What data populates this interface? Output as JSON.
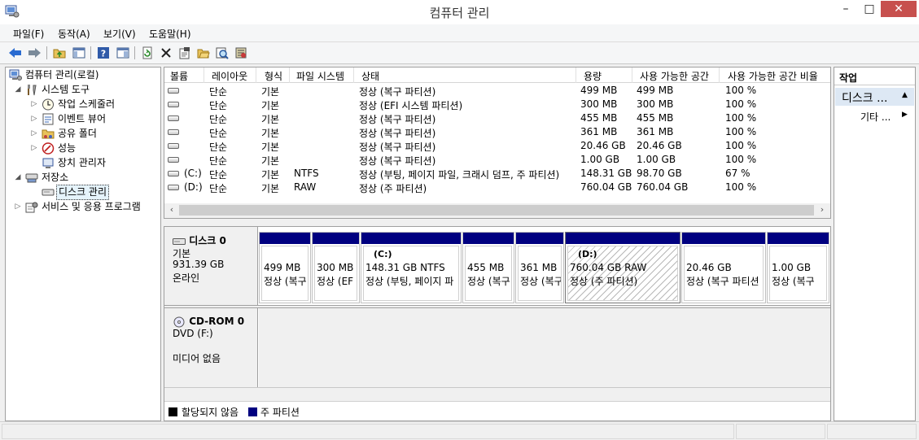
{
  "window": {
    "title": "컴퓨터 관리",
    "min": "–",
    "max": "□",
    "close": "✕"
  },
  "menu": [
    "파일(F)",
    "동작(A)",
    "보기(V)",
    "도움말(H)"
  ],
  "toolbar": [
    "back-icon",
    "forward-icon",
    "up-folder-icon",
    "show-hide-tree-icon",
    "help-icon",
    "properties-pane-icon",
    "refresh-icon",
    "delete-icon",
    "properties-icon",
    "open-folder-icon",
    "search-icon",
    "settings-icon"
  ],
  "tree": {
    "root": "컴퓨터 관리(로컬)",
    "system_tools": "시스템 도구",
    "task_scheduler": "작업 스케줄러",
    "event_viewer": "이벤트 뷰어",
    "shared_folders": "공유 폴더",
    "performance": "성능",
    "device_manager": "장치 관리자",
    "storage": "저장소",
    "disk_management": "디스크 관리",
    "services": "서비스 및 응용 프로그램"
  },
  "volume_list": {
    "columns": [
      "볼륨",
      "레이아웃",
      "형식",
      "파일 시스템",
      "상태",
      "용량",
      "사용 가능한 공간",
      "사용 가능한 공간 비율"
    ],
    "rows": [
      [
        "",
        "단순",
        "기본",
        "",
        "정상 (복구 파티션)",
        "499 MB",
        "499 MB",
        "100 %"
      ],
      [
        "",
        "단순",
        "기본",
        "",
        "정상 (EFI 시스템 파티션)",
        "300 MB",
        "300 MB",
        "100 %"
      ],
      [
        "",
        "단순",
        "기본",
        "",
        "정상 (복구 파티션)",
        "455 MB",
        "455 MB",
        "100 %"
      ],
      [
        "",
        "단순",
        "기본",
        "",
        "정상 (복구 파티션)",
        "361 MB",
        "361 MB",
        "100 %"
      ],
      [
        "",
        "단순",
        "기본",
        "",
        "정상 (복구 파티션)",
        "20.46 GB",
        "20.46 GB",
        "100 %"
      ],
      [
        "",
        "단순",
        "기본",
        "",
        "정상 (복구 파티션)",
        "1.00 GB",
        "1.00 GB",
        "100 %"
      ],
      [
        "(C:)",
        "단순",
        "기본",
        "NTFS",
        "정상 (부팅, 페이지 파일, 크래시 덤프, 주 파티션)",
        "148.31 GB",
        "98.70 GB",
        "67 %"
      ],
      [
        "(D:)",
        "단순",
        "기본",
        "RAW",
        "정상 (주 파티션)",
        "760.04 GB",
        "760.04 GB",
        "100 %"
      ]
    ]
  },
  "disk0": {
    "name": "디스크 0",
    "type": "기본",
    "size": "931.39 GB",
    "status": "온라인",
    "partitions": [
      {
        "name": "",
        "size": "499 MB",
        "status": "정상 (복구"
      },
      {
        "name": "",
        "size": "300 MB",
        "status": "정상 (EF"
      },
      {
        "name": "(C:)",
        "size": "148.31 GB NTFS",
        "status": "정상 (부팅, 페이지 파"
      },
      {
        "name": "",
        "size": "455 MB",
        "status": "정상 (복구"
      },
      {
        "name": "",
        "size": "361 MB",
        "status": "정상 (복구"
      },
      {
        "name": "(D:)",
        "size": "760.04 GB RAW",
        "status": "정상 (주 파티션)"
      },
      {
        "name": "",
        "size": "20.46 GB",
        "status": "정상 (복구 파티션"
      },
      {
        "name": "",
        "size": "1.00 GB",
        "status": "정상 (복구"
      }
    ]
  },
  "cdrom": {
    "name": "CD-ROM 0",
    "drive": "DVD (F:)",
    "status": "미디어 없음"
  },
  "legend": {
    "unallocated": "할당되지 않음",
    "primary": "주 파티션"
  },
  "actions": {
    "title": "작업",
    "section": "디스크 ...",
    "more": "기타 ..."
  },
  "colors": {
    "primary_partition": "#000080",
    "unallocated": "#000000",
    "action_section_bg": "#dde8f4"
  }
}
